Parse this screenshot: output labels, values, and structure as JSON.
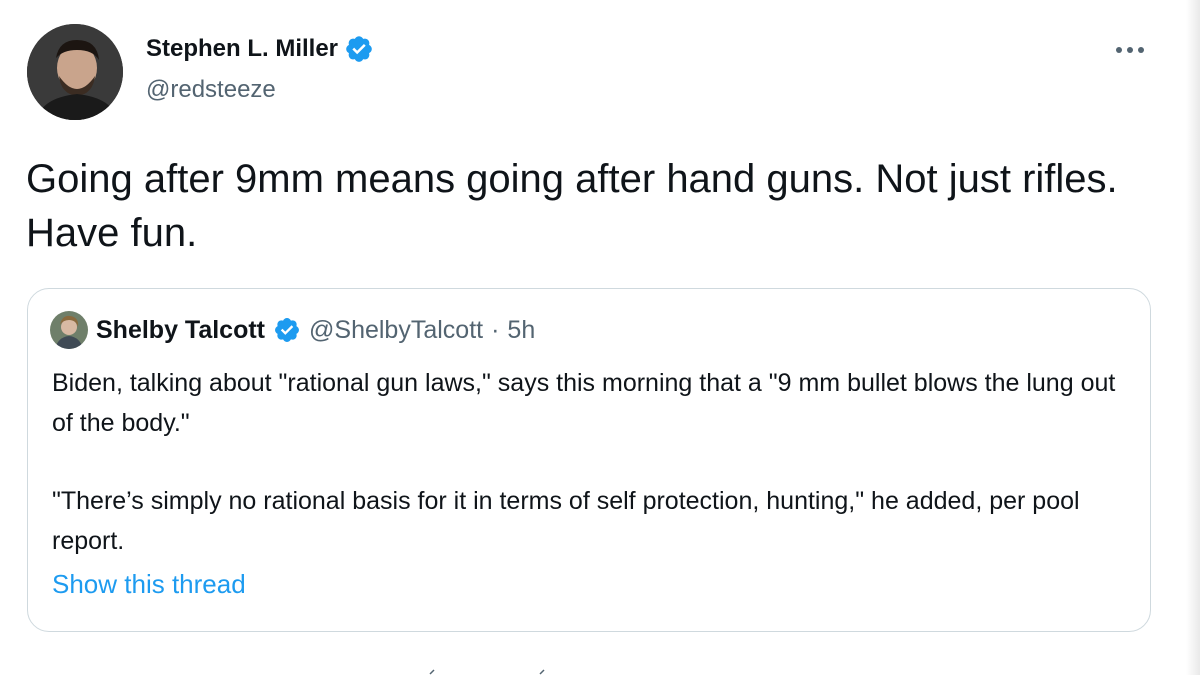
{
  "author": {
    "name": "Stephen L. Miller",
    "handle": "@redsteeze",
    "verified": true,
    "avatar_icon": "profile-photo-avatar"
  },
  "tweet": {
    "text": "Going after 9mm means going after hand guns. Not just rifles. Have fun."
  },
  "quoted_tweet": {
    "name": "Shelby Talcott",
    "handle": "@ShelbyTalcott",
    "separator": "·",
    "time": "5h",
    "verified": true,
    "paragraphs": [
      "Biden, talking about \"rational gun laws,\" says this morning that a \"9 mm bullet blows the lung out of the body.\"",
      "\"There’s simply no rational basis for it in terms of self protection, hunting,\" he added, per pool report."
    ],
    "show_thread_label": "Show this thread"
  },
  "icons": {
    "more": "more-options-icon",
    "verified": "verified-badge-icon"
  },
  "colors": {
    "accent": "#1d9bf0",
    "text_primary": "#0f1419",
    "text_secondary": "#536471",
    "border": "#cfd9de"
  }
}
